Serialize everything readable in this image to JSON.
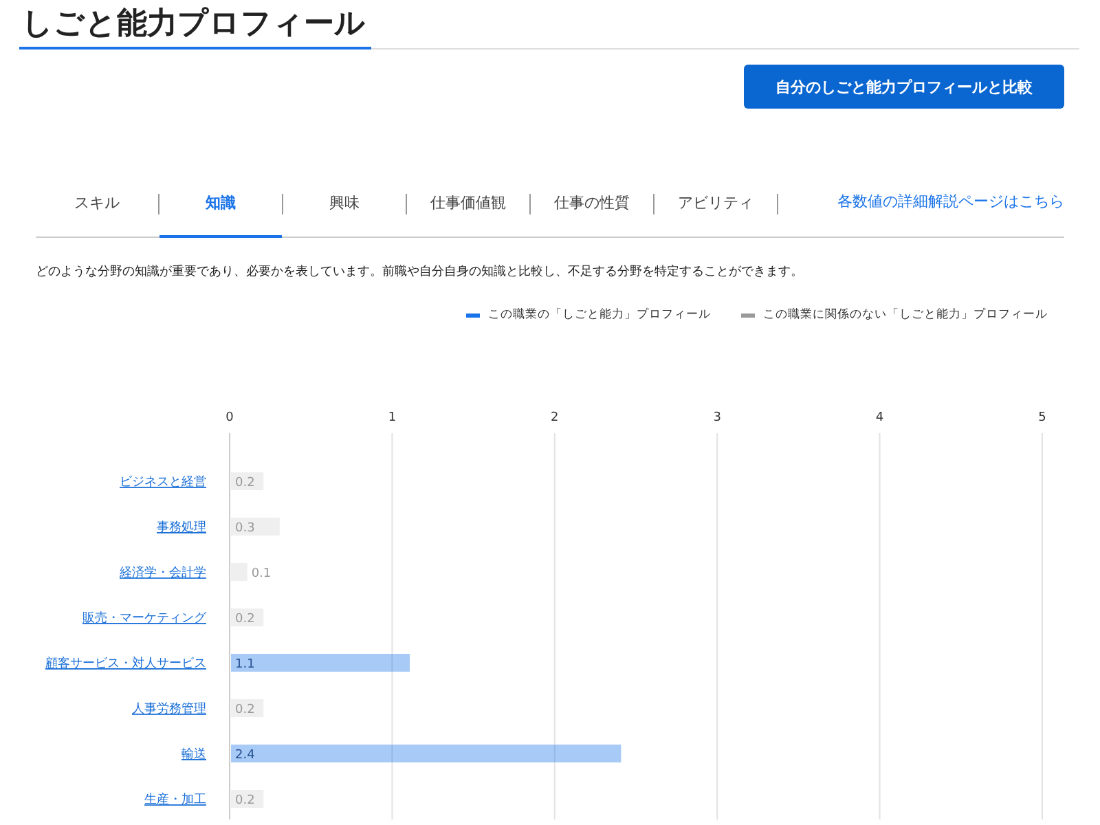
{
  "page_title": "しごと能力プロフィール",
  "compare_button": "自分のしごと能力プロフィールと比較",
  "tabs": [
    {
      "label": "スキル",
      "selected": false
    },
    {
      "label": "知識",
      "selected": true
    },
    {
      "label": "興味",
      "selected": false
    },
    {
      "label": "仕事価値観",
      "selected": false
    },
    {
      "label": "仕事の性質",
      "selected": false
    },
    {
      "label": "アビリティ",
      "selected": false
    }
  ],
  "detail_link": "各数値の詳細解説ページはこちら",
  "description": "どのような分野の知識が重要であり、必要かを表しています。前職や自分自身の知識と比較し、不足する分野を特定することができます。",
  "chart": {
    "chart_data": {
      "type": "bar",
      "orientation": "horizontal",
      "stacked": true,
      "grid": true,
      "data_labels": true,
      "xlim": [
        0,
        5
      ],
      "xticks": [
        0,
        1,
        2,
        3,
        4,
        5
      ],
      "categories": [
        "ビジネスと経営",
        "事務処理",
        "経済学・会計学",
        "販売・マーケティング",
        "顧客サービス・対人サービス",
        "人事労務管理",
        "輸送",
        "生産・加工"
      ],
      "series": [
        {
          "name": "この職業の「しごと能力」プロフィール",
          "color": "#1a73e8",
          "values": [
            null,
            null,
            null,
            null,
            1.1,
            null,
            2.4,
            null
          ]
        },
        {
          "name": "この職業に関係のない「しごと能力」プロフィール",
          "color": "#999999",
          "values": [
            0.2,
            0.3,
            0.1,
            0.2,
            null,
            0.2,
            null,
            0.2
          ]
        }
      ]
    }
  }
}
